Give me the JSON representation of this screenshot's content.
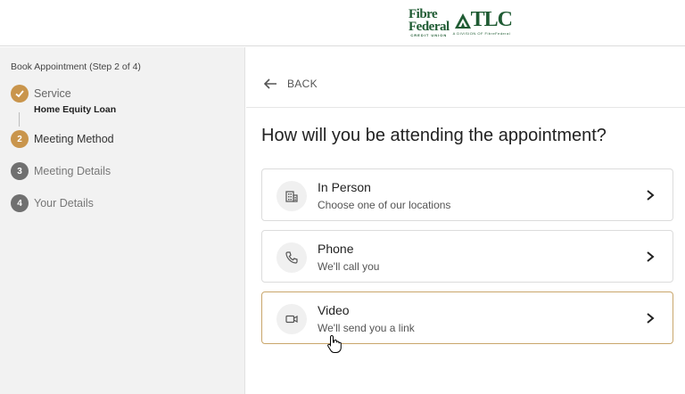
{
  "header": {
    "logo_fibre_line1": "Fibre",
    "logo_fibre_line2": "Federal",
    "logo_fibre_tagline": "CREDIT UNION",
    "logo_tlc": "TLC",
    "logo_tlc_tagline": "A DIVISION OF FibreFederal"
  },
  "sidebar": {
    "title": "Book Appointment (Step 2 of 4)",
    "steps": [
      {
        "number": "✓",
        "label": "Service",
        "sub": "Home Equity Loan"
      },
      {
        "number": "2",
        "label": "Meeting Method"
      },
      {
        "number": "3",
        "label": "Meeting Details"
      },
      {
        "number": "4",
        "label": "Your Details"
      }
    ]
  },
  "main": {
    "back_label": "BACK",
    "question": "How will you be attending the appointment?",
    "options": [
      {
        "title": "In Person",
        "subtitle": "Choose one of our locations",
        "icon": "building-icon"
      },
      {
        "title": "Phone",
        "subtitle": "We'll call you",
        "icon": "phone-icon"
      },
      {
        "title": "Video",
        "subtitle": "We'll send you a link",
        "icon": "video-camera-icon"
      }
    ]
  },
  "colors": {
    "accent_gold": "#c9954c",
    "brand_green": "#1f5b33",
    "step_grey": "#707070",
    "selected_border": "#c9a66b"
  }
}
